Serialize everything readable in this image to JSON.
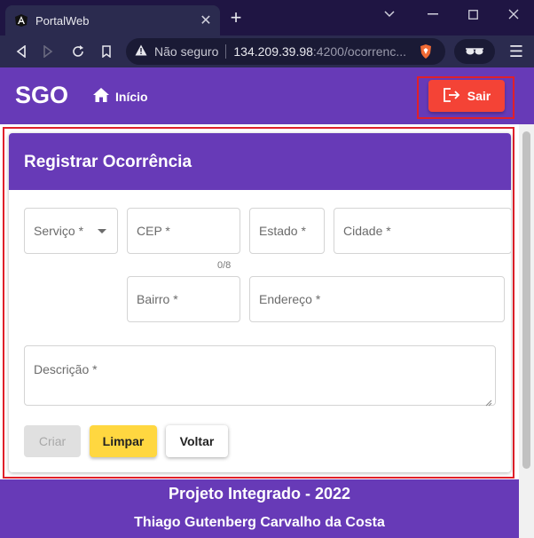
{
  "browser": {
    "tab_title": "PortalWeb",
    "tab_close": "✕",
    "new_tab": "+",
    "address": {
      "security_label": "Não seguro",
      "host": "134.209.39.98",
      "path": ":4200/ocorrenc..."
    },
    "menu": "☰"
  },
  "header": {
    "brand": "SGO",
    "home_label": "Início",
    "logout_label": "Sair"
  },
  "form": {
    "title": "Registrar Ocorrência",
    "fields": {
      "servico": "Serviço *",
      "cep": "CEP *",
      "cep_counter": "0/8",
      "estado": "Estado *",
      "cidade": "Cidade *",
      "bairro": "Bairro *",
      "endereco": "Endereço *",
      "descricao": "Descrição *"
    },
    "buttons": {
      "criar": "Criar",
      "limpar": "Limpar",
      "voltar": "Voltar"
    }
  },
  "footer": {
    "title": "Projeto Integrado - 2022",
    "author": "Thiago Gutenberg Carvalho da Costa"
  },
  "colors": {
    "primary": "#673ab7",
    "warn": "#f44336",
    "accent": "#ffd740",
    "highlight_outline": "#e0202a"
  }
}
